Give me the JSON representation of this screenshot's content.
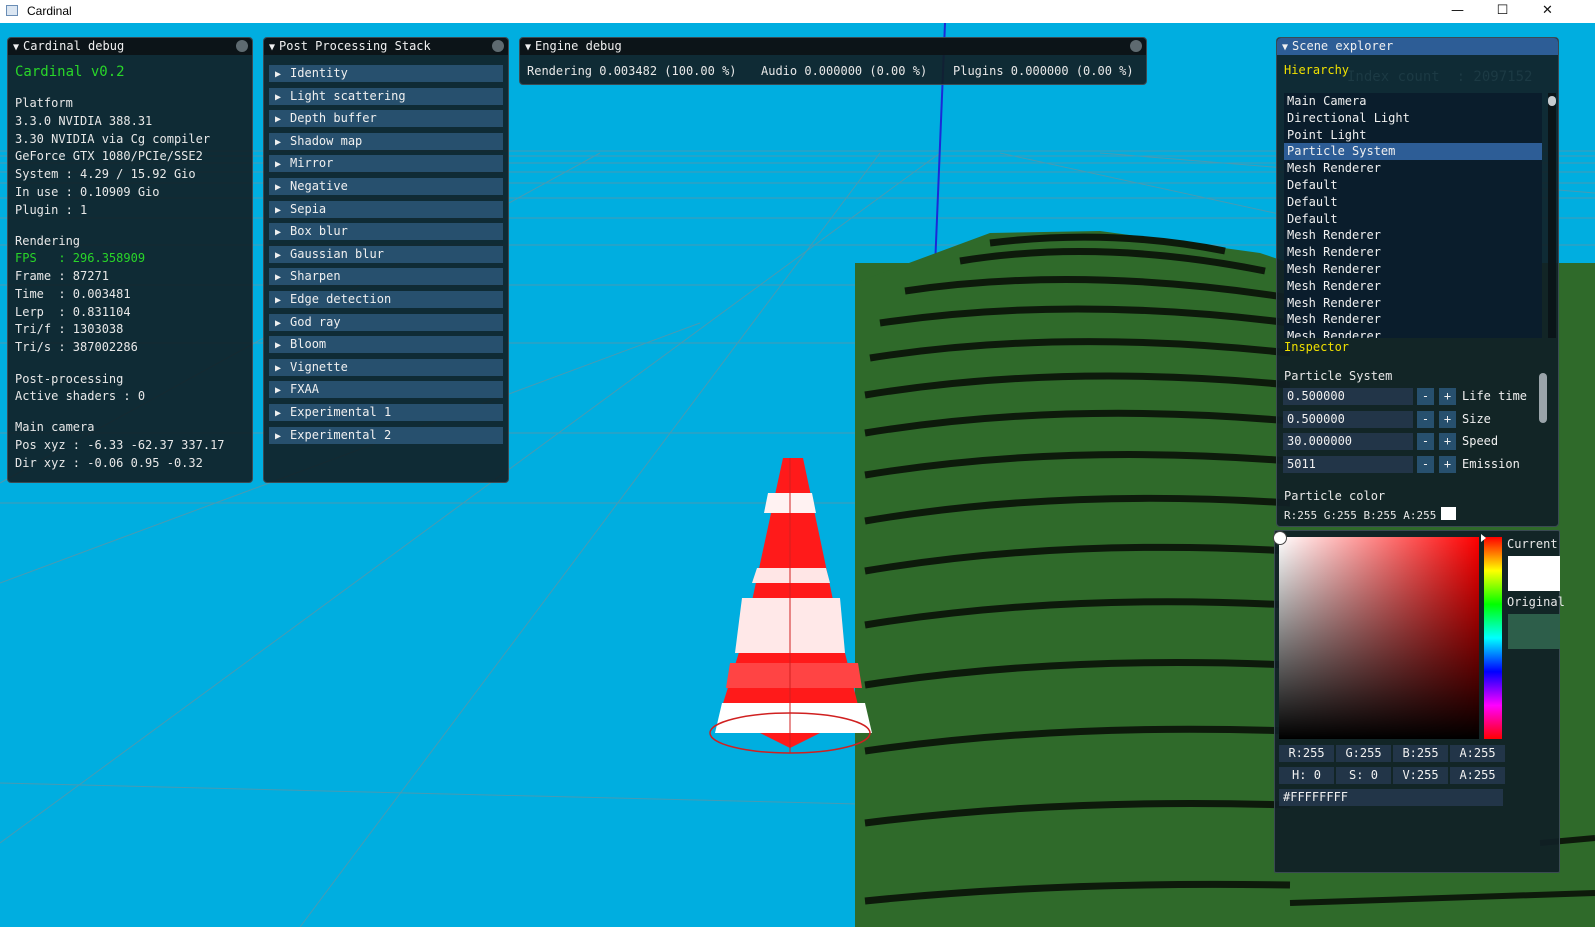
{
  "window": {
    "title": "Cardinal",
    "minimize": "—",
    "maximize": "☐",
    "close": "✕"
  },
  "cardinal_debug": {
    "title": "Cardinal debug",
    "version": "Cardinal v0.2",
    "platform_header": "Platform",
    "platform": [
      "3.3.0 NVIDIA 388.31",
      "3.30 NVIDIA via Cg compiler",
      "GeForce GTX 1080/PCIe/SSE2",
      "System : 4.29 / 15.92 Gio",
      "In use : 0.10909 Gio",
      "Plugin : 1"
    ],
    "rendering_header": "Rendering",
    "fps": "FPS   : 296.358909",
    "rendering": [
      "Frame : 87271",
      "Time  : 0.003481",
      "Lerp  : 0.831104",
      "Tri/f : 1303038",
      "Tri/s : 387002286"
    ],
    "post_header": "Post-processing",
    "post": "Active shaders : 0",
    "camera_header": "Main camera",
    "camera": [
      "Pos xyz : -6.33 -62.37 337.17",
      "Dir xyz : -0.06 0.95 -0.32"
    ]
  },
  "post_processing": {
    "title": "Post Processing Stack",
    "items": [
      "Identity",
      "Light scattering",
      "Depth buffer",
      "Shadow map",
      "Mirror",
      "Negative",
      "Sepia",
      "Box blur",
      "Gaussian blur",
      "Sharpen",
      "Edge detection",
      "God ray",
      "Bloom",
      "Vignette",
      "FXAA",
      "Experimental 1",
      "Experimental 2"
    ]
  },
  "engine_debug": {
    "title": "Engine debug",
    "rendering": "Rendering 0.003482 (100.00 %)",
    "audio": "Audio 0.000000 (0.00 %)",
    "plugins": "Plugins 0.000000 (0.00 %)"
  },
  "scene_explorer": {
    "title": "Scene explorer",
    "hierarchy_label": "Hierarchy",
    "background_text": "Index count  : 2097152",
    "hierarchy": [
      "Main Camera",
      "Directional Light",
      "Point Light",
      "Particle System",
      "Mesh Renderer",
      "Default",
      "Default",
      "Default",
      "Mesh Renderer",
      "Mesh Renderer",
      "Mesh Renderer",
      "Mesh Renderer",
      "Mesh Renderer",
      "Mesh Renderer",
      "Mesh Renderer"
    ],
    "selected": "Particle System",
    "inspector_label": "Inspector",
    "component": "Particle System",
    "fields": [
      {
        "value": "0.500000",
        "label": "Life time"
      },
      {
        "value": "0.500000",
        "label": "Size"
      },
      {
        "value": "30.000000",
        "label": "Speed"
      },
      {
        "value": "5011",
        "label": "Emission"
      }
    ],
    "minus": "-",
    "plus": "+",
    "color_label": "Particle color",
    "color_values": "R:255 G:255 B:255 A:255",
    "swatch_color": "#ffffff"
  },
  "color_picker": {
    "current_label": "Current",
    "original_label": "Original",
    "current_color": "#ffffff",
    "original_color": "#2d5e4a",
    "hue_color": "#ff0000",
    "rgba": [
      "R:255",
      "G:255",
      "B:255",
      "A:255"
    ],
    "hsva": [
      "H:  0",
      "S:  0",
      "V:255",
      "A:255"
    ],
    "hex": "#FFFFFFFF"
  },
  "colors": {
    "sky": "#00aee0",
    "grass": "#2f6a2a",
    "panel": "#102026",
    "selected": "#2d5d96",
    "button": "#27506e"
  }
}
